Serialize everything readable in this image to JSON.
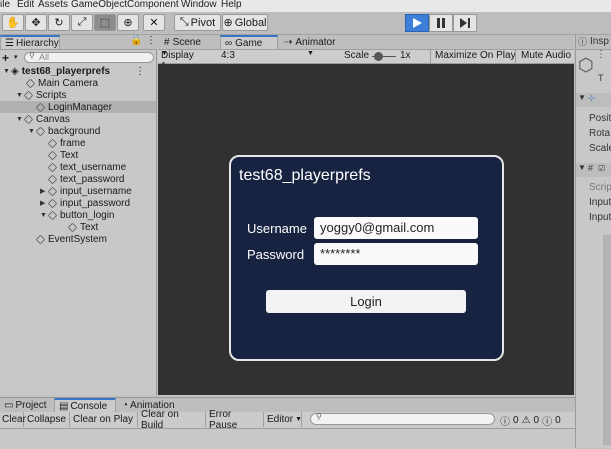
{
  "menu": [
    "ile",
    "Edit",
    "Assets",
    "GameObject",
    "Component",
    "Window",
    "Help"
  ],
  "toolbar": {
    "pivot_label": "Pivot",
    "global_label": "Global"
  },
  "hierarchy": {
    "tab_label": "Hierarchy",
    "search_placeholder": "All",
    "add_label": "+",
    "scene_name": "test68_playerprefs",
    "items": [
      "Main Camera",
      "Scripts",
      "LoginManager",
      "Canvas",
      "background",
      "frame",
      "Text",
      "text_username",
      "text_password",
      "input_username",
      "input_password",
      "button_login",
      "Text",
      "EventSystem"
    ]
  },
  "center_tabs": {
    "scene": "Scene",
    "game": "Game",
    "animator": "Animator"
  },
  "game_bar": {
    "display": "Display 1",
    "aspect": "4:3",
    "scale_label": "Scale",
    "scale_value": "1x",
    "maximize": "Maximize On Play",
    "mute": "Mute Audio"
  },
  "login": {
    "title": "test68_playerprefs",
    "username_label": "Username",
    "username_value": "yoggy0@gmail.com",
    "password_label": "Password",
    "password_value": "********",
    "button_label": "Login"
  },
  "inspector": {
    "tab_label": "Insp",
    "rows": [
      "T",
      "Posit",
      "Rota",
      "Scale",
      "Scrip",
      "Input",
      "Input"
    ]
  },
  "bottom_tabs": {
    "project": "Project",
    "console": "Console",
    "animation": "Animation"
  },
  "console_bar": {
    "clear": "Clear",
    "collapse": "Collapse",
    "clear_on_play": "Clear on Play",
    "clear_on_build": "Clear on Build",
    "error_pause": "Error Pause",
    "editor": "Editor",
    "info_count": "0",
    "warn_count": "0",
    "error_count": "0"
  },
  "colors": {
    "play_active": "#3d7fd8",
    "login_panel_bg": "#172340",
    "viewport_bg": "#313131"
  }
}
